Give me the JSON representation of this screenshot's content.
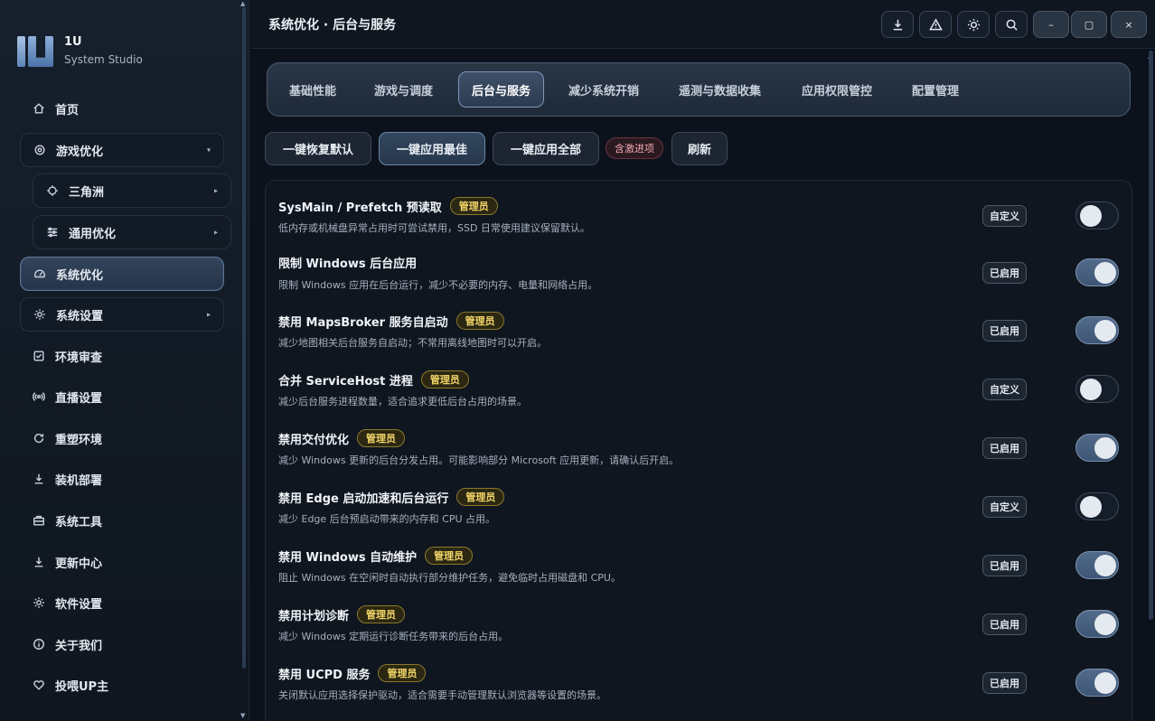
{
  "brand": {
    "name": "1U",
    "subtitle": "System Studio"
  },
  "sidebar": {
    "items": [
      {
        "label": "首页",
        "icon": "home-icon"
      },
      {
        "label": "游戏优化",
        "icon": "target-icon"
      },
      {
        "label": "三角洲",
        "icon": "crosshair-icon"
      },
      {
        "label": "通用优化",
        "icon": "sliders-icon"
      },
      {
        "label": "系统优化",
        "icon": "gauge-icon"
      },
      {
        "label": "系统设置",
        "icon": "gear-icon"
      },
      {
        "label": "环境审查",
        "icon": "checkbox-icon"
      },
      {
        "label": "直播设置",
        "icon": "broadcast-icon"
      },
      {
        "label": "重塑环境",
        "icon": "refresh-icon"
      },
      {
        "label": "装机部署",
        "icon": "download-icon"
      },
      {
        "label": "系统工具",
        "icon": "toolbox-icon"
      },
      {
        "label": "更新中心",
        "icon": "download-icon"
      },
      {
        "label": "软件设置",
        "icon": "gear-icon"
      },
      {
        "label": "关于我们",
        "icon": "info-icon"
      },
      {
        "label": "投喂UP主",
        "icon": "heart-icon"
      }
    ]
  },
  "header": {
    "title": "系统优化 · 后台与服务",
    "buttons": [
      "download-icon",
      "warning-icon",
      "sun-icon",
      "search-icon",
      "minimize-icon",
      "maximize-icon",
      "close-icon"
    ],
    "minimize_glyph": "–",
    "maximize_glyph": "▢",
    "close_glyph": "×"
  },
  "tabs": [
    {
      "label": "基础性能"
    },
    {
      "label": "游戏与调度"
    },
    {
      "label": "后台与服务",
      "active": true
    },
    {
      "label": "减少系统开销"
    },
    {
      "label": "遥测与数据收集"
    },
    {
      "label": "应用权限管控"
    },
    {
      "label": "配置管理"
    }
  ],
  "actions": {
    "restore": "一键恢复默认",
    "apply_best": "一键应用最佳",
    "apply_all": "一键应用全部",
    "aggressive_tag": "含激进项",
    "refresh": "刷新"
  },
  "admin_badge": "管理员",
  "settings": [
    {
      "title": "SysMain / Prefetch 预读取",
      "admin": true,
      "desc": "低内存或机械盘异常占用时可尝试禁用，SSD 日常使用建议保留默认。",
      "state": "自定义",
      "on": false
    },
    {
      "title": "限制 Windows 后台应用",
      "admin": false,
      "desc": "限制 Windows 应用在后台运行，减少不必要的内存、电量和网络占用。",
      "state": "已启用",
      "on": true
    },
    {
      "title": "禁用 MapsBroker 服务自启动",
      "admin": true,
      "desc": "减少地图相关后台服务自启动；不常用离线地图时可以开启。",
      "state": "已启用",
      "on": true
    },
    {
      "title": "合并 ServiceHost 进程",
      "admin": true,
      "desc": "减少后台服务进程数量，适合追求更低后台占用的场景。",
      "state": "自定义",
      "on": false
    },
    {
      "title": "禁用交付优化",
      "admin": true,
      "desc": "减少 Windows 更新的后台分发占用。可能影响部分 Microsoft 应用更新，请确认后开启。",
      "state": "已启用",
      "on": true
    },
    {
      "title": "禁用 Edge 启动加速和后台运行",
      "admin": true,
      "desc": "减少 Edge 后台预启动带来的内存和 CPU 占用。",
      "state": "自定义",
      "on": false
    },
    {
      "title": "禁用 Windows 自动维护",
      "admin": true,
      "desc": "阻止 Windows 在空闲时自动执行部分维护任务，避免临时占用磁盘和 CPU。",
      "state": "已启用",
      "on": true
    },
    {
      "title": "禁用计划诊断",
      "admin": true,
      "desc": "减少 Windows 定期运行诊断任务带来的后台占用。",
      "state": "已启用",
      "on": true
    },
    {
      "title": "禁用 UCPD 服务",
      "admin": true,
      "desc": "关闭默认应用选择保护驱动，适合需要手动管理默认浏览器等设置的场景。",
      "state": "已启用",
      "on": true
    }
  ]
}
